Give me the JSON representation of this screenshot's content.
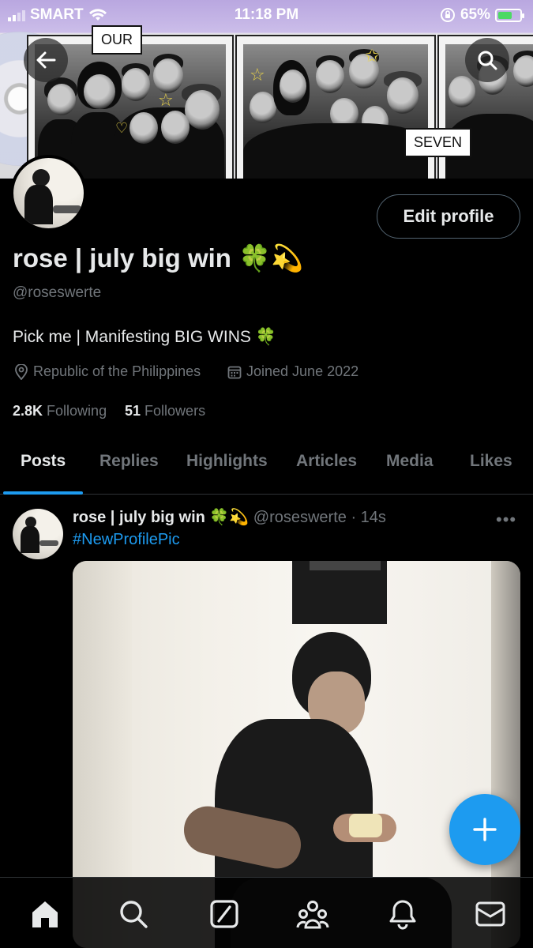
{
  "status_bar": {
    "carrier": "SMART",
    "time": "11:18 PM",
    "battery": "65%",
    "battery_level": 0.65
  },
  "banner": {
    "sticker_our": "OUR",
    "sticker_seven": "SEVEN"
  },
  "profile": {
    "edit_button": "Edit profile",
    "name": "rose | july big win 🍀💫",
    "handle": "@roseswerte",
    "bio": "Pick me | Manifesting BIG WINS 🍀",
    "location": "Republic of the Philippines",
    "joined": "Joined June 2022",
    "following_count": "2.8K",
    "following_label": "Following",
    "followers_count": "51",
    "followers_label": "Followers"
  },
  "tabs": [
    {
      "label": "Posts",
      "active": true
    },
    {
      "label": "Replies",
      "active": false
    },
    {
      "label": "Highlights",
      "active": false
    },
    {
      "label": "Articles",
      "active": false
    },
    {
      "label": "Media",
      "active": false
    },
    {
      "label": "Likes",
      "active": false
    }
  ],
  "post": {
    "name": "rose | july big win 🍀💫",
    "handle_time": "@roseswerte · 14s",
    "more": "•••",
    "text": "#NewProfilePic"
  },
  "icons": {
    "back": "back-arrow-icon",
    "search": "search-icon",
    "compose": "plus-icon",
    "nav": [
      "home-icon",
      "search-icon",
      "grok-icon",
      "communities-icon",
      "notifications-icon",
      "messages-icon"
    ]
  },
  "colors": {
    "accent": "#1d9bf0",
    "background": "#000000",
    "text_primary": "#e7e9ea",
    "text_secondary": "#71767b",
    "border": "#2f3336"
  }
}
